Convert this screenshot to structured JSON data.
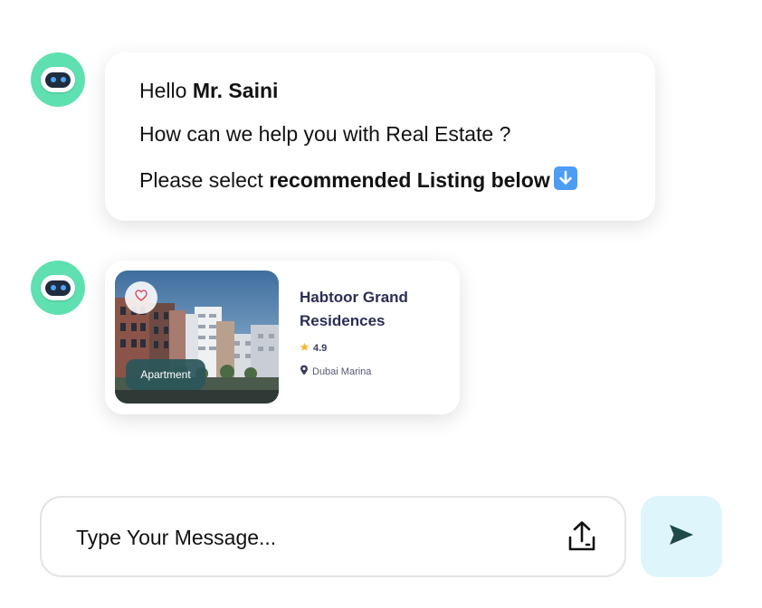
{
  "greeting": {
    "hello": "Hello ",
    "name": "Mr. Saini",
    "question": "How can we help you with Real Estate ?",
    "select_prefix": "Please select ",
    "select_bold": "recommended Listing below"
  },
  "listing": {
    "title": "Habtoor Grand Residences",
    "rating": "4.9",
    "location": "Dubai Marina",
    "type": "Apartment",
    "favorited": false
  },
  "composer": {
    "placeholder": "Type Your Message..."
  },
  "icons": {
    "bot_avatar": "robot-icon",
    "arrow_emoji": "down-arrow-emoji",
    "favorite": "heart-icon",
    "rating": "star-icon",
    "location": "map-pin-icon",
    "upload": "upload-icon",
    "send": "send-icon"
  },
  "colors": {
    "avatar_bg": "#5ee0b0",
    "title_text": "#2b2e54",
    "star": "#f5b82e",
    "chip_bg": "#2a565a",
    "send_bg": "#def5fc",
    "send_icon": "#1e4a4a"
  }
}
